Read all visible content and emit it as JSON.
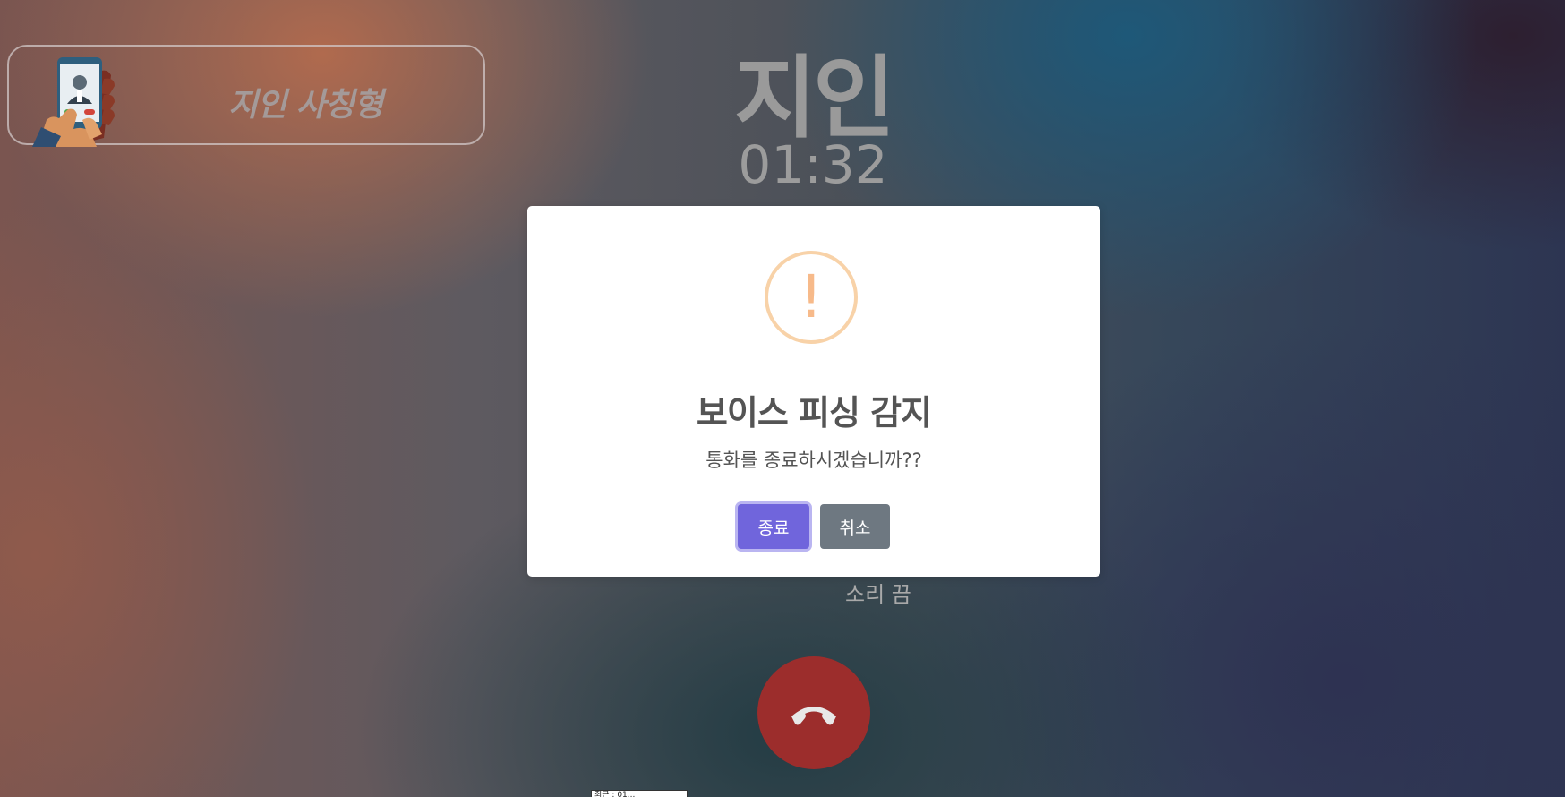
{
  "scenario": {
    "label": "지인 사칭형",
    "illustration": "phone-call-illustration"
  },
  "call": {
    "caller_name": "지인",
    "timer": "01:32",
    "mute_label": "소리 끔",
    "end_call_icon": "phone-hangup-icon",
    "bottom_tag": "최근 : 01..."
  },
  "dialog": {
    "icon": "warning-icon",
    "icon_glyph": "!",
    "title": "보이스 피싱 감지",
    "message": "통화를 종료하시겠습니까??",
    "confirm_label": "종료",
    "cancel_label": "취소"
  },
  "colors": {
    "end_call": "#9c2d2c",
    "confirm_button": "#7065dc",
    "cancel_button": "#6e7881",
    "warning": "#f8d2a8"
  }
}
